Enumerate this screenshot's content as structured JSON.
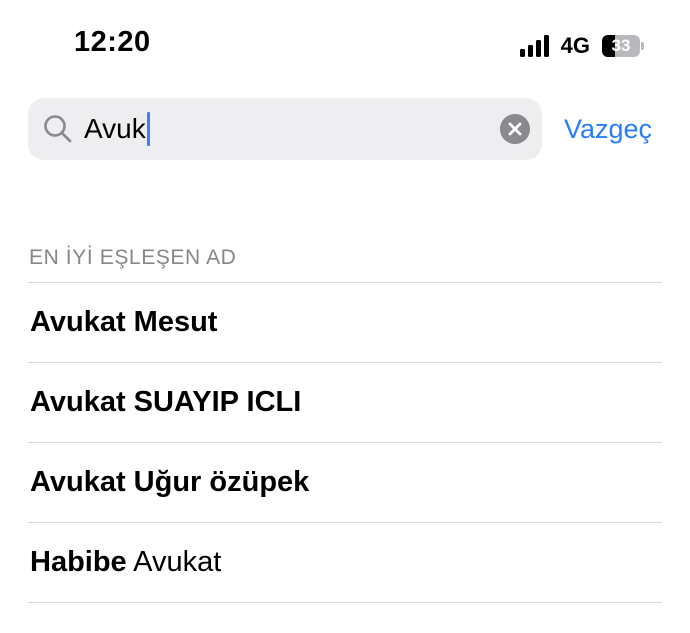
{
  "status_bar": {
    "time": "12:20",
    "network": "4G",
    "battery_level": "33",
    "battery_fraction": 0.33,
    "signal_bars": 4
  },
  "search": {
    "query": "Avuk",
    "cancel_label": "Vazgeç",
    "icon": "search-icon",
    "clear_icon": "clear-icon"
  },
  "section": {
    "header": "EN İYİ EŞLEŞEN AD"
  },
  "results": [
    {
      "bold": "Avukat Mesut",
      "regular": ""
    },
    {
      "bold": "Avukat SUAYIP ICLI",
      "regular": ""
    },
    {
      "bold": "Avukat Uğur özüpek",
      "regular": ""
    },
    {
      "bold": "Habibe",
      "regular": " Avukat"
    }
  ],
  "colors": {
    "accent": "#2a7ef5",
    "caret": "#3a82f7",
    "section_header": "#86868b",
    "separator": "#d8d8dc",
    "search_field_bg": "#eeeef0"
  }
}
